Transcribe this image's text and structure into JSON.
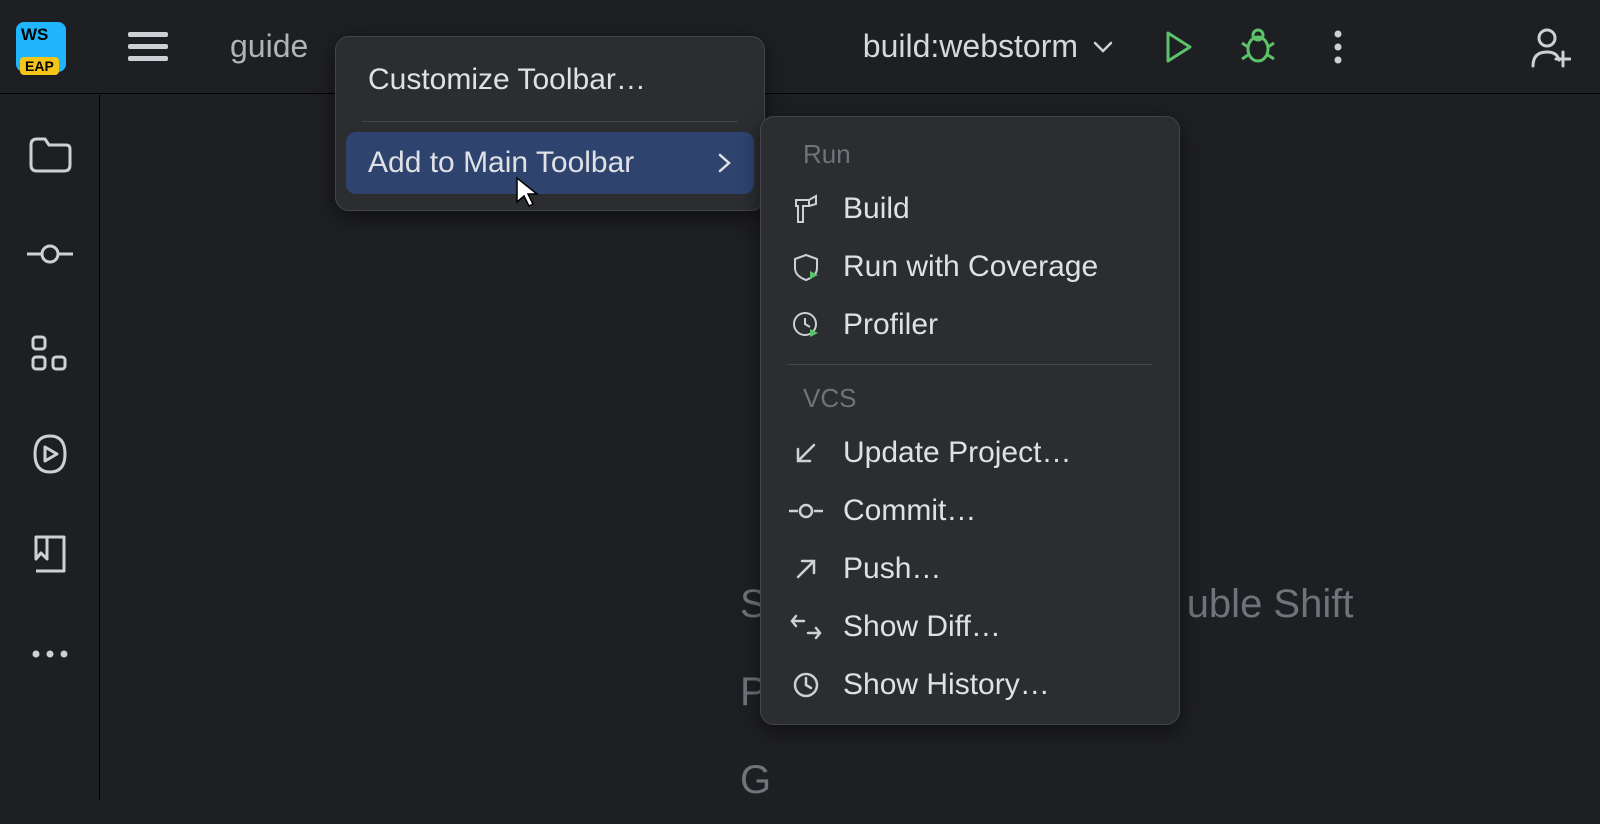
{
  "toolbar": {
    "breadcrumb": "guide",
    "run_config": "build:webstorm"
  },
  "context_menu": {
    "customize": "Customize Toolbar…",
    "add_main": "Add to Main Toolbar"
  },
  "submenu": {
    "section_run": "Run",
    "build": "Build",
    "coverage": "Run with Coverage",
    "profiler": "Profiler",
    "section_vcs": "VCS",
    "update": "Update Project…",
    "commit": "Commit…",
    "push": "Push…",
    "diff": "Show Diff…",
    "history": "Show History…"
  },
  "hints": {
    "line1_start": "S",
    "line1_end": "uble Shift",
    "line2": "P",
    "line3": "G"
  }
}
